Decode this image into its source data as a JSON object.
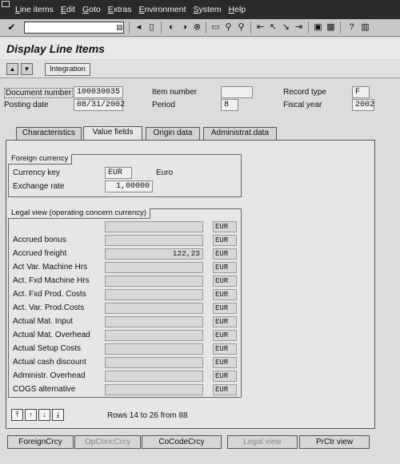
{
  "menu": [
    "Line items",
    "Edit",
    "Goto",
    "Extras",
    "Environment",
    "System",
    "Help"
  ],
  "toolbar": {
    "icons": [
      "enter-icon",
      "save-icon",
      "back-icon",
      "exit-icon",
      "cancel-icon",
      "print-icon",
      "find-icon",
      "find-next-icon",
      "first-page-icon",
      "prev-page-icon",
      "next-page-icon",
      "last-page-icon",
      "new-session-icon",
      "shortcut-icon",
      "help-icon",
      "customize-layout-icon"
    ]
  },
  "title": "Display Line Items",
  "apptool": {
    "integration_label": "Integration"
  },
  "header": {
    "document_number_label": "Document number",
    "document_number": "100030035",
    "item_number_label": "Item number",
    "item_number": "",
    "record_type_label": "Record type",
    "record_type": "F",
    "posting_date_label": "Posting date",
    "posting_date": "08/31/2002",
    "period_label": "Period",
    "period": "8",
    "fiscal_year_label": "Fiscal year",
    "fiscal_year": "2002"
  },
  "tabs": [
    "Characteristics",
    "Value fields",
    "Origin data",
    "Administrat.data"
  ],
  "foreign_currency": {
    "title": "Foreign currency",
    "currency_key_label": "Currency key",
    "currency_key": "EUR",
    "currency_name": "Euro",
    "exchange_rate_label": "Exchange rate",
    "exchange_rate": "1,00000"
  },
  "legal_view": {
    "title": "Legal view (operating concern currency)",
    "rows": [
      {
        "label": "",
        "value": "",
        "currency": "EUR"
      },
      {
        "label": "Accrued bonus",
        "value": "",
        "currency": "EUR"
      },
      {
        "label": "Accrued freight",
        "value": "122,23",
        "currency": "EUR"
      },
      {
        "label": "Act Var. Machine Hrs",
        "value": "",
        "currency": "EUR"
      },
      {
        "label": "Act. Fxd Machine Hrs",
        "value": "",
        "currency": "EUR"
      },
      {
        "label": "Act. Fxd Prod. Costs",
        "value": "",
        "currency": "EUR"
      },
      {
        "label": "Act. Var. Prod.Costs",
        "value": "",
        "currency": "EUR"
      },
      {
        "label": "Actual Mat. Input",
        "value": "",
        "currency": "EUR"
      },
      {
        "label": "Actual Mat. Overhead",
        "value": "",
        "currency": "EUR"
      },
      {
        "label": "Actual Setup Costs",
        "value": "",
        "currency": "EUR"
      },
      {
        "label": "Actual cash discount",
        "value": "",
        "currency": "EUR"
      },
      {
        "label": "Administr. Overhead",
        "value": "",
        "currency": "EUR"
      },
      {
        "label": "COGS alternative",
        "value": "",
        "currency": "EUR"
      }
    ],
    "rows_info": "Rows 14  to 26  from 88"
  },
  "bottom_buttons": [
    {
      "label": "ForeignCrcy",
      "enabled": true
    },
    {
      "label": "OpConcCrcy",
      "enabled": false
    },
    {
      "label": "CoCodeCrcy",
      "enabled": true
    },
    {
      "label": "Legal view",
      "enabled": false
    },
    {
      "label": "PrCtr view",
      "enabled": true
    }
  ]
}
